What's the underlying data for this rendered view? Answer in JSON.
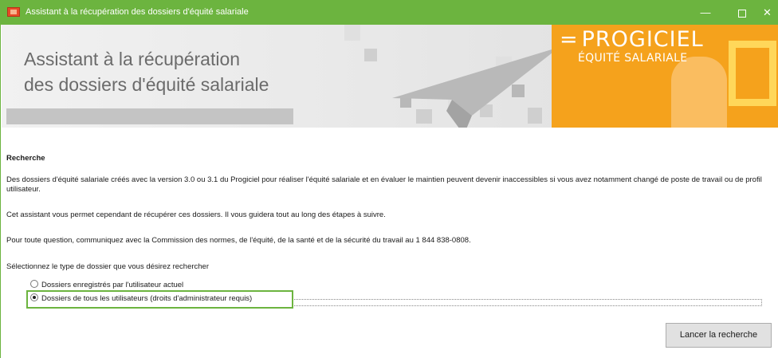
{
  "window": {
    "title": "Assistant à la récupération des dossiers d'équité salariale",
    "controls": {
      "minimize": "—",
      "close": "✕"
    }
  },
  "banner": {
    "heading_line1": "Assistant à la récupération",
    "heading_line2": "des dossiers d'équité salariale",
    "brand_main": "PROGICIEL",
    "brand_prefix": "=",
    "brand_sub": "ÉQUITÉ SALARIALE"
  },
  "content": {
    "section_title": "Recherche",
    "paragraph1": "Des dossiers d'équité salariale créés avec la version 3.0 ou 3.1 du Progiciel pour réaliser l'équité salariale et en évaluer le maintien peuvent devenir inaccessibles si vous avez notamment changé de poste de travail ou de profil utilisateur.",
    "paragraph2": "Cet assistant vous permet cependant de récupérer ces dossiers. Il vous guidera tout au long des étapes à suivre.",
    "paragraph3": "Pour toute question, communiquez avec la Commission des normes, de l'équité, de la santé et de la sécurité du travail au 1 844 838-0808.",
    "prompt": "Sélectionnez le type de dossier que vous désirez rechercher",
    "options": [
      {
        "label": "Dossiers enregistrés par l'utilisateur actuel",
        "checked": false
      },
      {
        "label": "Dossiers de tous les utilisateurs (droits d'administrateur requis)",
        "checked": true
      }
    ],
    "search_button": "Lancer la recherche"
  },
  "colors": {
    "titlebar": "#6cb43f",
    "brand_orange": "#f5a21c",
    "focus_border": "#6cb43f"
  }
}
